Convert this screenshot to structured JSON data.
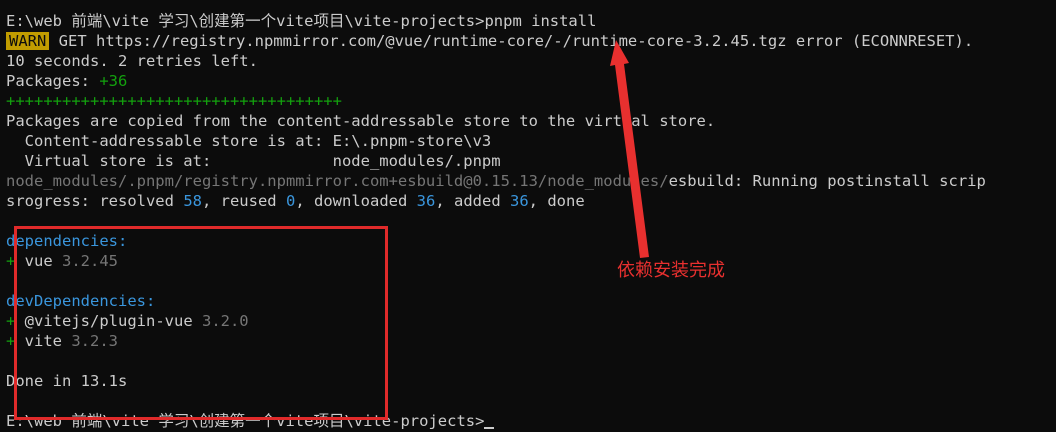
{
  "terminal": {
    "lines": {
      "l1": "E:\\web 前端\\vite 学习\\创建第一个vite项目\\vite-projects>pnpm install",
      "l2_warn": "WARN",
      "l2_msg": " GET https://registry.npmmirror.com/@vue/runtime-core/-/runtime-core-3.2.45.tgz error (ECONNRESET).",
      "l3": "10 seconds. 2 retries left.",
      "l4_label": "Packages: ",
      "l4_count": "+36",
      "l5": "++++++++++++++++++++++++++++++++++++",
      "l6": "Packages are copied from the content-addressable store to the virtual store.",
      "l7": "  Content-addressable store is at: E:\\.pnpm-store\\v3",
      "l8": "  Virtual store is at:             node_modules/.pnpm",
      "l9_dim": "node_modules/.pnpm/registry.npmmirror.com+esbuild@0.15.13/node_modules/",
      "l9_text": "esbuild: Running postinstall scrip",
      "l10_a": "srogress: resolved ",
      "l10_n1": "58",
      "l10_b": ", reused ",
      "l10_n2": "0",
      "l10_c": ", downloaded ",
      "l10_n3": "36",
      "l10_d": ", added ",
      "l10_n4": "36",
      "l10_e": ", done",
      "l12": "dependencies:",
      "l13_plus": "+",
      "l13_name": " vue ",
      "l13_ver": "3.2.45",
      "l15": "devDependencies:",
      "l16_plus": "+",
      "l16_name": " @vitejs/plugin-vue ",
      "l16_ver": "3.2.0",
      "l17_plus": "+",
      "l17_name": " vite ",
      "l17_ver": "3.2.3",
      "l19": "Done in 13.1s",
      "l21": "E:\\web 前端\\vite 学习\\创建第一个vite项目\\vite-projects>"
    }
  },
  "annotation": {
    "text": "依赖安装完成",
    "color": "#e8302f"
  },
  "colors": {
    "background": "#0c0c0c",
    "text": "#cccccc",
    "green": "#13a10e",
    "cyan": "#3a96dd",
    "warn_bg": "#c19c00",
    "highlight_box": "#e02a2a"
  }
}
